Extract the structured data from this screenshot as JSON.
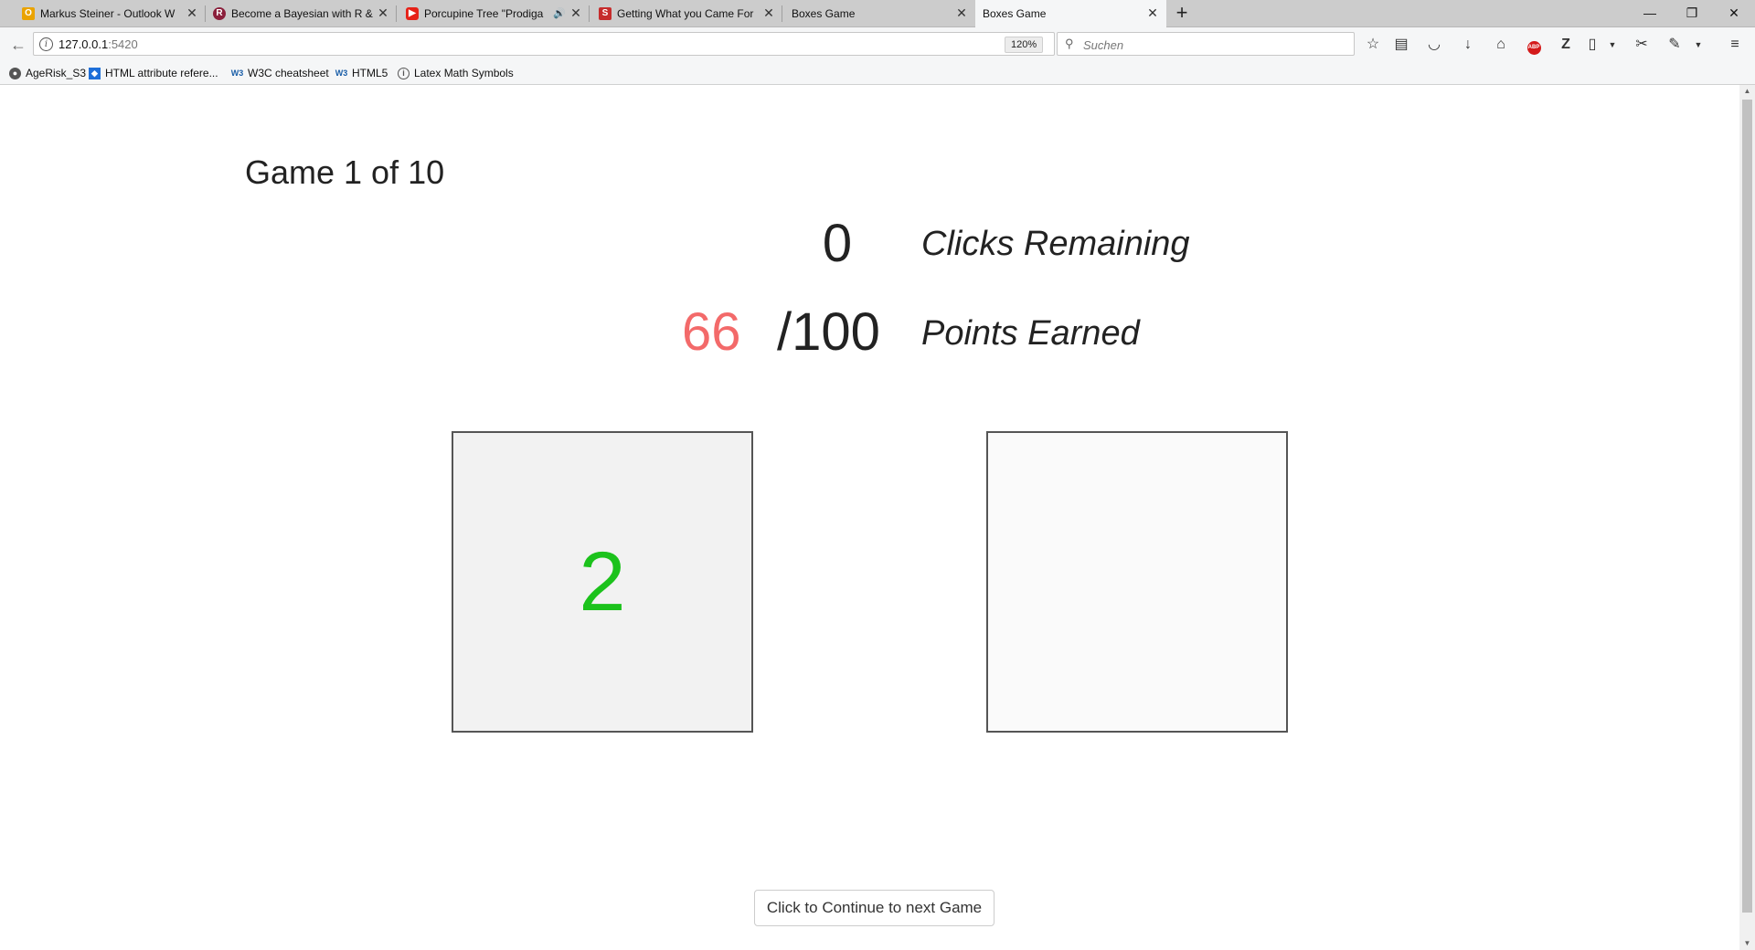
{
  "browser": {
    "tabs": [
      {
        "title": "Markus Steiner - Outlook W",
        "icon": "outlook-icon",
        "color": "#eaa300",
        "active": false
      },
      {
        "title": "Become a Bayesian with R &",
        "icon": "r-icon",
        "color": "#8b1f3b",
        "active": false
      },
      {
        "title": "Porcupine Tree \"Prodiga",
        "icon": "youtube-icon",
        "color": "#e62117",
        "active": false,
        "audio": true
      },
      {
        "title": "Getting What you Came For",
        "icon": "s-icon",
        "color": "#c62c2c",
        "active": false
      },
      {
        "title": "Boxes Game",
        "icon": "none",
        "active": false
      },
      {
        "title": "Boxes Game",
        "icon": "none",
        "active": true
      }
    ],
    "new_tab_glyph": "+",
    "window_controls": {
      "minimize": "—",
      "restore": "❐",
      "close": "✕"
    },
    "address": {
      "host": "127.0.0.1",
      "port": ":5420",
      "zoom": "120%"
    },
    "search": {
      "placeholder": "Suchen"
    },
    "bookmarks": [
      {
        "label": "AgeRisk_S3",
        "icon": "globe-icon"
      },
      {
        "label": "HTML attribute refere...",
        "icon": "mdn-icon"
      },
      {
        "label": "W3C cheatsheet",
        "icon": "w3c-icon"
      },
      {
        "label": "HTML5",
        "icon": "w3c-icon"
      },
      {
        "label": "Latex Math Symbols",
        "icon": "latex-icon"
      }
    ]
  },
  "game": {
    "title": "Game 1 of 10",
    "clicks_remaining": "0",
    "clicks_label": "Clicks Remaining",
    "points_earned": "66",
    "points_total": "/100",
    "points_label": "Points Earned",
    "points_earned_color": "#f36a6a",
    "box_value_color": "#1cc21c",
    "boxes": [
      {
        "value": "2",
        "revealed": true
      },
      {
        "value": "",
        "revealed": false
      }
    ],
    "continue_label": "Click to Continue to next Game"
  }
}
